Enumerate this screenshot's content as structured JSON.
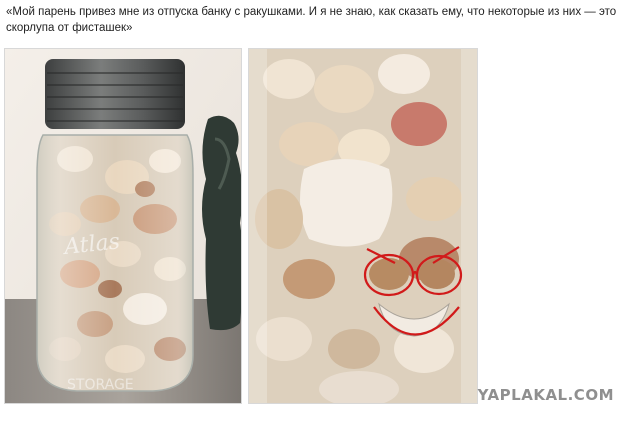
{
  "post": {
    "caption": "«Мой парень привез мне из отпуска банку с ракушками. И я не знаю, как сказать ему, что некоторые из них — это скорлупа от фисташек»"
  },
  "images": [
    {
      "name": "jar-of-seashells-photo",
      "embossed_text": "STORAGE"
    },
    {
      "name": "jar-closeup-pistachio-face-photo"
    }
  ],
  "site": {
    "watermark": "YAPLAKAL.COM"
  },
  "colors": {
    "annotation": "#d11a1a",
    "background": "#ffffff",
    "watermark": "#8f8f8f"
  }
}
